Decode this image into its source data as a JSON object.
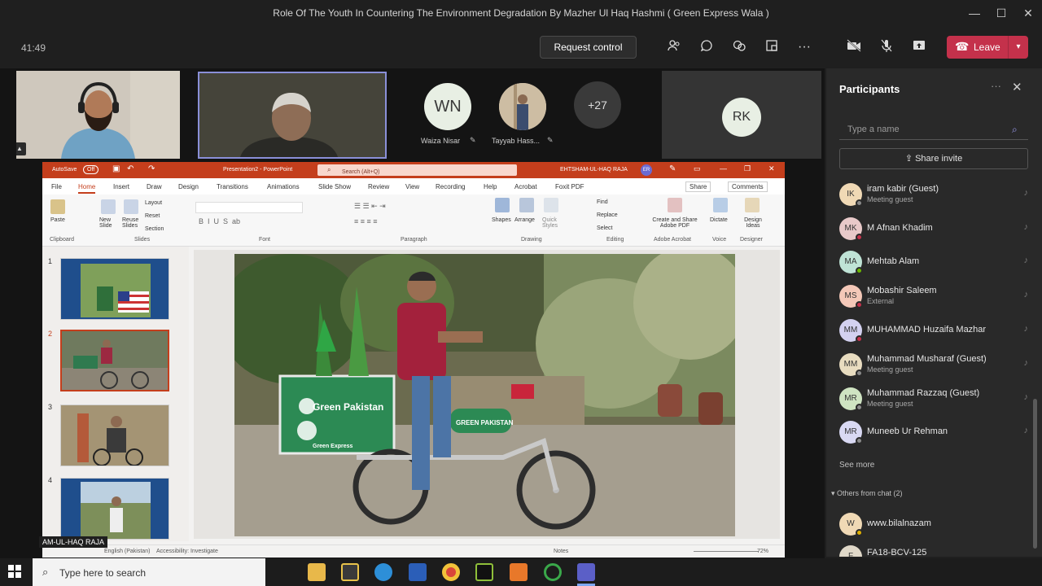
{
  "window": {
    "title": "Role Of The Youth In Countering The Environment Degradation By Mazher Ul Haq Hashmi ( Green Express Wala )",
    "minimize": "—",
    "maximize": "☐",
    "close": "✕"
  },
  "toolbar": {
    "timer": "41:49",
    "request_control": "Request control",
    "leave": "Leave"
  },
  "stage": {
    "tiles": [
      {
        "initials": "WN",
        "name": "Waiza Nisar"
      },
      {
        "name": "Tayyab Hass..."
      },
      {
        "overflow": "+27"
      },
      {
        "initials": "RK"
      }
    ],
    "presenter_tag": "AM-UL-HAQ RAJA"
  },
  "powerpoint": {
    "autosave": "AutoSave",
    "autosave_state": "Off",
    "doc": "Presentation2 - PowerPoint",
    "search": "Search (Alt+Q)",
    "user": "EHTSHAM-UL-HAQ RAJA",
    "user_initials": "ER",
    "tabs": [
      "File",
      "Home",
      "Insert",
      "Draw",
      "Design",
      "Transitions",
      "Animations",
      "Slide Show",
      "Review",
      "View",
      "Recording",
      "Help",
      "Acrobat",
      "Foxit PDF"
    ],
    "share": "Share",
    "comments": "Comments",
    "groups": [
      "Clipboard",
      "Slides",
      "Font",
      "Paragraph",
      "Drawing",
      "Editing",
      "Adobe Acrobat",
      "Voice",
      "Designer"
    ],
    "buttons": {
      "paste": "Paste",
      "new_slide": "New Slide",
      "reuse_slides": "Reuse Slides",
      "layout": "Layout",
      "reset": "Reset",
      "section": "Section",
      "shapes": "Shapes",
      "arrange": "Arrange",
      "quick_styles": "Quick Styles",
      "find": "Find",
      "replace": "Replace",
      "select": "Select",
      "create_pdf": "Create and Share Adobe PDF",
      "dictate": "Dictate",
      "design_ideas": "Design Ideas"
    },
    "slides": [
      "1",
      "2",
      "3",
      "4"
    ],
    "box_text": "Green Pakistan",
    "tank_text": "GREEN PAKISTAN",
    "box_sub": "Green Express",
    "status": {
      "lang": "English (Pakistan)",
      "accessibility": "Accessibility: Investigate",
      "notes": "Notes",
      "zoom": "72%"
    }
  },
  "participants": {
    "title": "Participants",
    "search_placeholder": "Type a name",
    "share_invite": "Share invite",
    "list": [
      {
        "initials": "IK",
        "name": "iram kabir (Guest)",
        "sub": "Meeting guest",
        "color": "#f0d9b5"
      },
      {
        "initials": "MK",
        "name": "M Afnan Khadim",
        "sub": "",
        "color": "#e8c9c9"
      },
      {
        "initials": "MA",
        "name": "Mehtab Alam",
        "sub": "",
        "color": "#bfe3d6"
      },
      {
        "initials": "MS",
        "name": "Mobashir Saleem",
        "sub": "External",
        "color": "#f4c8b8"
      },
      {
        "initials": "MM",
        "name": "MUHAMMAD Huzaifa Mazhar",
        "sub": "",
        "color": "#d3d1f0"
      },
      {
        "initials": "MM",
        "name": "Muhammad Musharaf (Guest)",
        "sub": "Meeting guest",
        "color": "#e8dcc0"
      },
      {
        "initials": "MR",
        "name": "Muhammad Razzaq (Guest)",
        "sub": "Meeting guest",
        "color": "#cfe4c2"
      },
      {
        "initials": "MR",
        "name": "Muneeb Ur Rehman",
        "sub": "",
        "color": "#d9d9f3"
      }
    ],
    "see_more": "See more",
    "others_from_chat": "Others from chat (2)",
    "chat_list": [
      {
        "initials": "W",
        "name": "www.bilalnazam",
        "color": "#f0d9b5"
      },
      {
        "initials": "F",
        "name": "FA18-BCV-125",
        "color": "#e0d8c8"
      }
    ]
  },
  "taskbar": {
    "search": "Type here to search"
  }
}
